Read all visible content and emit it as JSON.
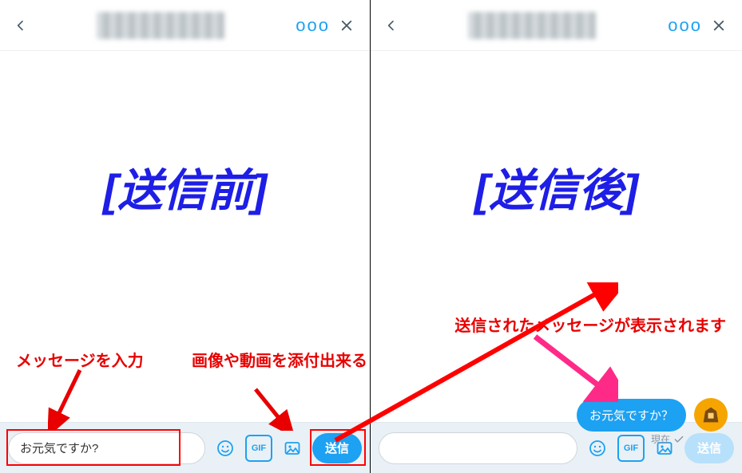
{
  "left": {
    "state_label": "[送信前]",
    "more_label": "ooo",
    "input_value": "お元気ですか?",
    "gif_label": "GIF",
    "send_label": "送信"
  },
  "right": {
    "state_label": "[送信後]",
    "more_label": "ooo",
    "bubble_text": "お元気ですか？",
    "timestamp": "現在",
    "gif_label": "GIF",
    "send_label": "送信"
  },
  "annotations": {
    "input_hint": "メッセージを入力",
    "attach_hint": "画像や動画を添付出来る",
    "sent_hint": "送信されたメッセージが表示されます"
  }
}
